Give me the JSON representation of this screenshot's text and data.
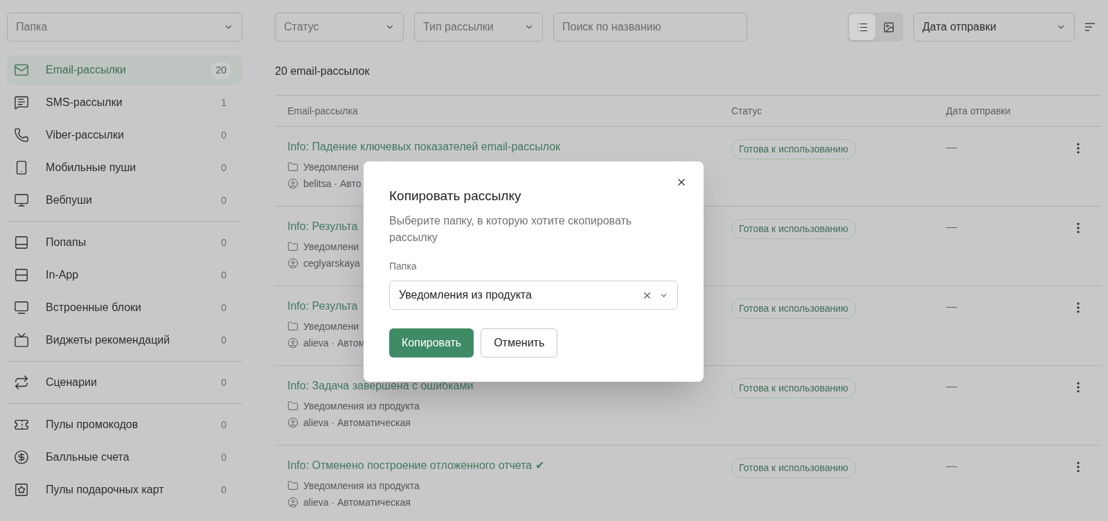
{
  "sidebar": {
    "folder_select": {
      "placeholder": "Папка"
    },
    "groups": [
      [
        {
          "label": "Email-рассылки",
          "count": "20",
          "selected": true
        },
        {
          "label": "SMS-рассылки",
          "count": "1",
          "selected": false
        },
        {
          "label": "Viber-рассылки",
          "count": "0",
          "selected": false
        },
        {
          "label": "Мобильные пуши",
          "count": "0",
          "selected": false
        },
        {
          "label": "Вебпуши",
          "count": "0",
          "selected": false
        }
      ],
      [
        {
          "label": "Попапы",
          "count": "0",
          "selected": false
        },
        {
          "label": "In-App",
          "count": "0",
          "selected": false
        },
        {
          "label": "Встроенные блоки",
          "count": "0",
          "selected": false
        },
        {
          "label": "Виджеты рекомендаций",
          "count": "0",
          "selected": false
        }
      ],
      [
        {
          "label": "Сценарии",
          "count": "0",
          "selected": false
        }
      ],
      [
        {
          "label": "Пулы промокодов",
          "count": "0",
          "selected": false
        },
        {
          "label": "Балльные счета",
          "count": "0",
          "selected": false
        },
        {
          "label": "Пулы подарочных карт",
          "count": "0",
          "selected": false
        }
      ]
    ]
  },
  "filters": {
    "status": {
      "placeholder": "Статус"
    },
    "type": {
      "placeholder": "Тип рассылки"
    },
    "search": {
      "placeholder": "Поиск по названию"
    },
    "views": [
      {
        "kind": "list",
        "selected": true
      },
      {
        "kind": "gallery",
        "selected": false
      }
    ],
    "sort": {
      "value": "Дата отправки"
    }
  },
  "count_label": "20 email-рассылок",
  "table": {
    "columns": [
      "Email-рассылка",
      "Статус",
      "Дата отправки"
    ],
    "rows": [
      {
        "title": "Info: Падение ключевых показателей email-рассылок",
        "folder": "Уведомлени",
        "meta": "belitsa · Авто",
        "status": "Готова к использованию",
        "date": "—"
      },
      {
        "title": "Info: Результа",
        "folder": "Уведомлени",
        "meta": "ceglyarskaya",
        "status": "Готова к использованию",
        "date": "—"
      },
      {
        "title": "Info: Результа",
        "folder": "Уведомлени",
        "meta": "alieva · Автом",
        "status": "Готова к использованию",
        "date": "—"
      },
      {
        "title": "Info: Задача завершена с ошибками",
        "folder": "Уведомления из продукта",
        "meta": "alieva · Автоматическая",
        "status": "Готова к использованию",
        "date": "—"
      },
      {
        "title": "Info: Отменено построение отложенного отчета ✔",
        "folder": "Уведомления из продукта",
        "meta": "alieva · Автоматическая",
        "status": "Готова к использованию",
        "date": "—"
      }
    ]
  },
  "dialog": {
    "title": "Копировать рассылку",
    "description": "Выберите папку, в которую хотите скопировать рассылку",
    "field_label": "Папка",
    "field_value": "Уведомления из продукта",
    "buttons": [
      {
        "label": "Копировать",
        "kind": "primary"
      },
      {
        "label": "Отменить",
        "kind": "secondary"
      }
    ]
  }
}
